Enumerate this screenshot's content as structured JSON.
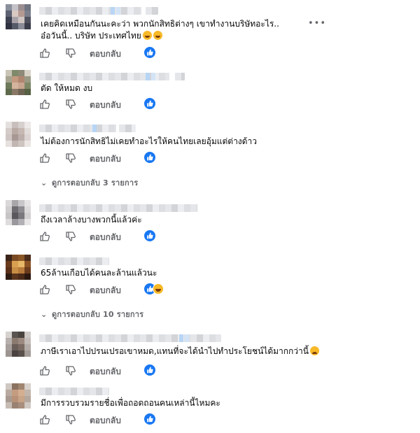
{
  "icons": {
    "like": "thumbs-up-icon",
    "dislike": "thumbs-down-icon",
    "reaction": "like-reaction-icon"
  },
  "colors": {
    "accent": "#1877f2",
    "secondary_text": "#65676b"
  },
  "comments": [
    {
      "text_lines": [
        "เคยคิดเหมือนกันนะคะว่า พวกนักสิทธิต่างๆ เขาทำงานบริษัทอะไร..",
        "อ๋อวันนี้.. บริษัท ประเทศไทย"
      ],
      "more_label": "•••",
      "reply_label": "ตอบกลับ"
    },
    {
      "text_lines": [
        "ตัด ให้หมด งบ"
      ],
      "reply_label": "ตอบกลับ"
    },
    {
      "text_lines": [
        "ไม่ต้องการนักสิทธิไม่เคยทำอะไรให้คนไทยเลยอุ้มแต่ต่างด้าว"
      ],
      "reply_label": "ตอบกลับ",
      "view_replies": "ดูการตอบกลับ 3 รายการ"
    },
    {
      "text_lines": [
        "ถึงเวลาล้างบางพวกนี้แล้วค่ะ"
      ],
      "reply_label": "ตอบกลับ"
    },
    {
      "text_lines": [
        "65ล้านเกือบได้คนละล้านแล้วนะ"
      ],
      "reply_label": "ตอบกลับ",
      "view_replies": "ดูการตอบกลับ 10 รายการ"
    },
    {
      "text_lines": [
        "ภาษีเราเอาไปปรนเปรอเขาหมด,แทนที่จะได้นำไปทำประโยชน์ได้มากกว่านี้"
      ],
      "reply_label": "ตอบกลับ"
    },
    {
      "text_lines": [
        "มีการรวบรวมรายชื่อเพื่อถอดถอนคนเหล่านี้ไหมคะ"
      ],
      "reply_label": "ตอบกลับ"
    }
  ]
}
